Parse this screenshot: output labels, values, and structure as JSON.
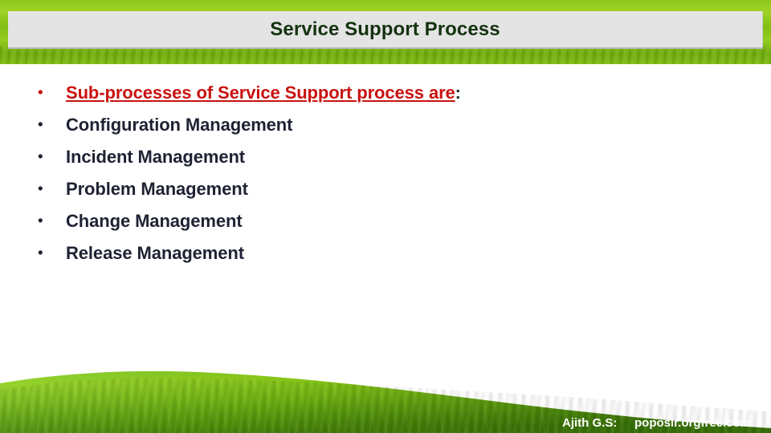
{
  "slide": {
    "title": "Service Support Process",
    "title_color": "#14320f",
    "plaque_color": "#e4e4e4",
    "banner_color": "#8ec71c",
    "body_text_color": "#1f2233",
    "highlight_color": "#c9110f"
  },
  "bullets": [
    {
      "label": "Sub-processes of Service Support process are",
      "tail": ":",
      "emphasis": "red-underline"
    },
    {
      "label": "Configuration Management",
      "tail": "",
      "emphasis": "none"
    },
    {
      "label": "Incident Management",
      "tail": "",
      "emphasis": "none"
    },
    {
      "label": "Problem Management",
      "tail": "",
      "emphasis": "none"
    },
    {
      "label": "Change Management",
      "tail": "",
      "emphasis": "none"
    },
    {
      "label": "Release Management",
      "tail": "",
      "emphasis": "none"
    }
  ],
  "bullet_glyph": "•",
  "footer": {
    "author": "Ajith G.S:",
    "site": "poposir.orgfree.com"
  }
}
